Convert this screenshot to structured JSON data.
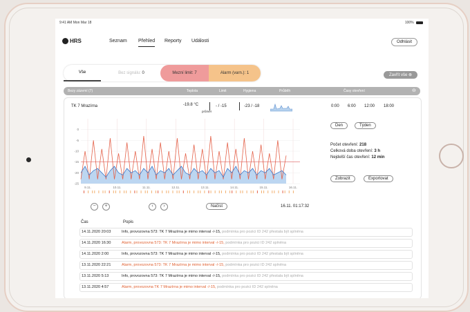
{
  "status": {
    "time": "9:41 AM  Mon Mar 18",
    "battery": "100%"
  },
  "nav": {
    "logo": "HRS",
    "links": [
      "Seznam",
      "Přehled",
      "Reporty",
      "Události"
    ],
    "active": "Přehled",
    "logout": "Odhlásit"
  },
  "filters": {
    "all": "Vše",
    "no_signal_label": "Bez signálu: ",
    "no_signal_count": "0",
    "critical": "Mezní limit: 7",
    "warning": "Alarm (varn.): 1",
    "close_all": "Zavřít vše"
  },
  "table_header": [
    "Bezy zázemí (7)",
    "Teplota",
    "Limit",
    "Hygiena",
    "Průběh",
    "Časy otevření"
  ],
  "detail": {
    "name": "TK 7 Mrazírna",
    "temp": "-19.8 °C",
    "temp_sub": "průměr",
    "limit": "- / -15",
    "range": "-23 / -18",
    "times": [
      "0:00",
      "6:00",
      "12:00",
      "18:00"
    ],
    "day_btn": "Den",
    "week_btn": "Týden",
    "stats": [
      {
        "label": "Počet otevření:",
        "value": "218"
      },
      {
        "label": "Celková doba otevření:",
        "value": "3 h"
      },
      {
        "label": "Nejdelší čas otevření:",
        "value": "12 min"
      }
    ],
    "show_btn": "Zobrazit",
    "export_btn": "Exportovat",
    "load_btn": "Načíst",
    "timestamp": "16.11. 01:17:32",
    "zoom_out": "−",
    "zoom_in": "+",
    "prev": "‹",
    "next": "›"
  },
  "chart_data": {
    "type": "line",
    "ylim": [
      -25,
      5
    ],
    "y_ticks": [
      "0",
      "-5",
      "-10",
      "-15",
      "-20",
      "-25"
    ],
    "x_ticks": [
      "9.11.",
      "10.11.",
      "11.11.",
      "12.11.",
      "13.11.",
      "14.11.",
      "15.11.",
      "16.11."
    ],
    "limit_line": -15,
    "series": [
      {
        "values": [
          -20,
          -17,
          -21,
          -19,
          -18,
          -20,
          -22,
          -19,
          -17,
          -20,
          -21,
          -18,
          -20,
          -19,
          -21,
          -18,
          -20,
          -17,
          -21,
          -19,
          -20,
          -18,
          -21,
          -19,
          -17,
          -20,
          -21,
          -18,
          -20,
          -19,
          -21,
          -18,
          -20,
          -19,
          -22,
          -18,
          -20,
          -17,
          -21,
          -19,
          -20,
          -18,
          -21,
          -19,
          -20,
          -18,
          -21,
          -20,
          -19,
          -21
        ]
      },
      {
        "values": [
          -23,
          -10,
          -23,
          -5,
          -23,
          -9,
          -23,
          -4,
          -23,
          -11,
          -23,
          -6,
          -23,
          -10,
          -23,
          -3,
          -23,
          -9,
          -23,
          -6,
          -23,
          -10,
          -23,
          -4,
          -23,
          -11,
          -23,
          -7,
          -23,
          -9,
          -23,
          -3,
          -23,
          -10,
          -23,
          -6,
          -23,
          -9,
          -23,
          -4,
          -23,
          -10,
          -23,
          -7,
          -23,
          -11,
          -23,
          -5,
          -23,
          -12
        ]
      }
    ]
  },
  "events": {
    "col_time": "Čas",
    "col_desc": "Popis",
    "rows": [
      {
        "date": "14.11.2020 20:03",
        "type": "info",
        "text": "Info, provozovna  573: TK 7 Mrazírna je mimo interval -/-15,",
        "tail": " podmínka pro pozici ID 242 přestala být splněna"
      },
      {
        "date": "14.11.2020 16:30",
        "type": "alarm",
        "text": "Alarm, provozovna  573: TK 7 Mrazírna je mimo interval -/-15,",
        "tail": " podmínka pro pozici ID 242 splněna"
      },
      {
        "date": "14.11.2020 2:00",
        "type": "info",
        "text": "Info, provozovna  573: TK 7 Mrazírna je mimo interval -/-15,",
        "tail": " podmínka pro pozici ID 242 přestala být splněna"
      },
      {
        "date": "13.11.2020 22:21",
        "type": "alarm",
        "text": "Alarm, provozovna  573: TK 7 Mrazírna je mimo interval -/-15,",
        "tail": " podmínka pro pozici ID 242 splněna"
      },
      {
        "date": "13.11.2020 5:13",
        "type": "info",
        "text": "Info, provozovna  573: TK 7 Mrazírna je mimo interval -/-15,",
        "tail": " podmínka pro pozici ID 242 přestala být splněna"
      },
      {
        "date": "13.11.2020 4:57",
        "type": "alarm",
        "text": "Alarm, provozovna TK 7 Mrazírna je mimo interval -/-15,",
        "tail": " podmínka pro pozici ID 242 splněna"
      }
    ]
  }
}
